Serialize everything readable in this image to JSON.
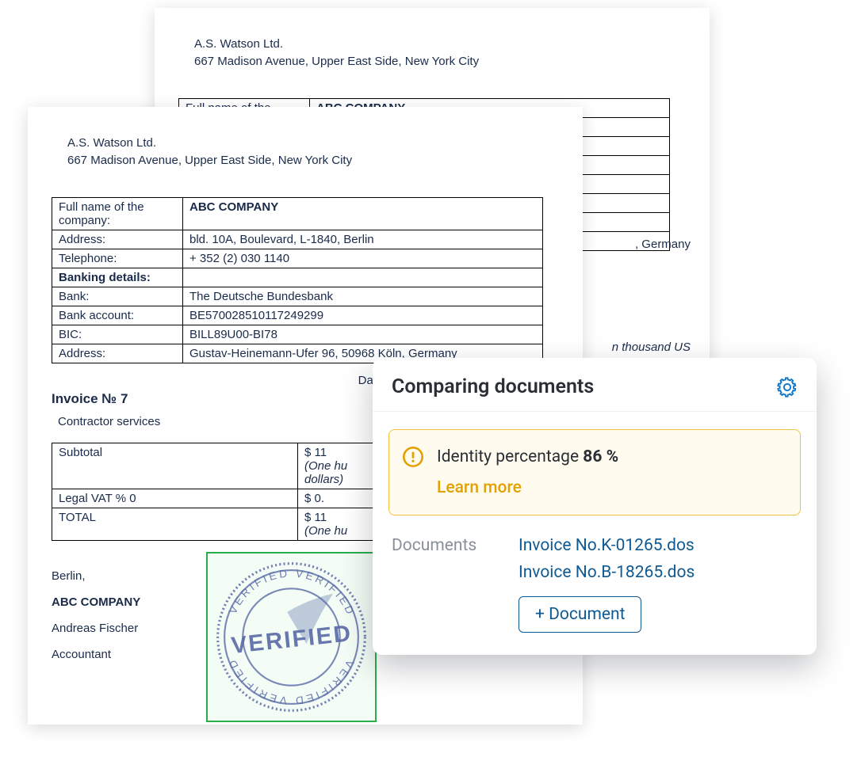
{
  "doc_back": {
    "sender_name": "A.S. Watson Ltd.",
    "sender_addr": "667 Madison Avenue, Upper East Side, New York City",
    "row_label_peek": "Full name of the",
    "row_value_peek": "ABC COMPANY",
    "germany_peek": ", Germany",
    "thousand_peek": "n thousand US"
  },
  "doc_front": {
    "sender_name": "A.S. Watson Ltd.",
    "sender_addr": "667 Madison Avenue, Upper East Side, New York City",
    "rows": [
      {
        "label": "Full name of the company:",
        "value": "ABC COMPANY",
        "value_bold": true
      },
      {
        "label": "Address:",
        "value": "bld. 10A, Boulevard, L-1840, Berlin"
      },
      {
        "label": "Telephone:",
        "value": "+ 352 (2) 030 1140"
      },
      {
        "label": "Banking details:",
        "value": "",
        "label_bold": true
      },
      {
        "label": "Bank:",
        "value": "The Deutsche Bundesbank"
      },
      {
        "label": "Bank account:",
        "value": "BE570028510117249299"
      },
      {
        "label": "BIC:",
        "value": "BILL89U00-BI78"
      },
      {
        "label": "Address:",
        "value": "Gustav-Heinemann-Ufer 96, 50968 Köln, Germany"
      }
    ],
    "invoice_no": "Invoice № 7",
    "invoice_date_partial": "Dat",
    "subtitle": "Contractor services",
    "amounts": [
      {
        "name": "Subtotal",
        "amt": "$      11",
        "words": "(One hu",
        "words2": "dollars)"
      },
      {
        "name": "Legal VAT  % 0",
        "amt": "$      0."
      },
      {
        "name": "TOTAL",
        "amt": "$      11",
        "words": "(One hu"
      }
    ],
    "sig_city": "Berlin,",
    "sig_company": "ABC COMPANY",
    "sig_name": "Andreas Fischer",
    "sig_role": "Accountant",
    "stamp_text": "VERIFIED"
  },
  "panel": {
    "title": "Comparing documents",
    "alert_prefix": "Identity percentage ",
    "alert_value": "86 %",
    "learn_more": "Learn more",
    "docs_label": "Documents",
    "docs": [
      "Invoice No.K-01265.dos",
      "Invoice No.B-18265.dos"
    ],
    "add_button": "+  Document"
  }
}
